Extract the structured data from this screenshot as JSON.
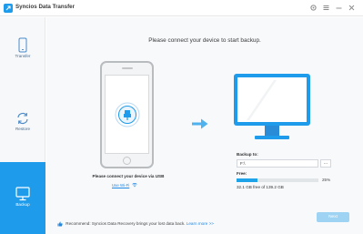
{
  "app": {
    "title": "Syncios Data Transfer",
    "logo_icon": "syncios-logo-icon"
  },
  "window_controls": [
    {
      "name": "settings-icon",
      "glyph": "⚙"
    },
    {
      "name": "menu-icon",
      "glyph": "≡"
    },
    {
      "name": "minimize-icon",
      "glyph": "–"
    },
    {
      "name": "close-icon",
      "glyph": "✕"
    }
  ],
  "sidebar": {
    "items": [
      {
        "label": "Transfer",
        "icon": "phone-icon",
        "active": false
      },
      {
        "label": "Restore",
        "icon": "restore-icon",
        "active": false
      },
      {
        "label": "Backup",
        "icon": "monitor-icon",
        "active": true
      }
    ]
  },
  "main": {
    "prompt": "Please connect your device to start backup.",
    "connect_text": "Please connect your device via USB",
    "wifi_link": "Use Wi-Fi",
    "backup_to_label": "Backup to:",
    "backup_path": "F:\\",
    "browse_label": "...",
    "free_label": "Free:",
    "free_percent_text": "25%",
    "free_fraction": 0.25,
    "free_text": "32.1 GB free of 139.2 GB",
    "recommend_text": "Recommend: Syncios Data Recovery brings your lost data back.",
    "learn_more": "Learn more >>",
    "next_label": "Next"
  },
  "colors": {
    "accent": "#1e9bea",
    "progress": "#1ea3e8",
    "next_disabled": "#9ed3f4",
    "link": "#1e88e5"
  }
}
